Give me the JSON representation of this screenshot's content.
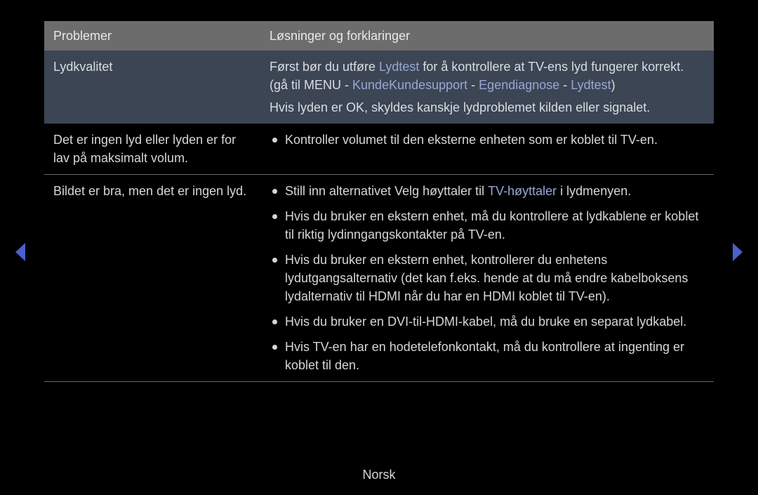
{
  "headers": {
    "problem": "Problemer",
    "solution": "Løsninger og forklaringer"
  },
  "row1": {
    "problem": "Lydkvalitet",
    "line1_pre": "Først bør du utføre ",
    "line1_hl": "Lydtest",
    "line1_post": " for å kontrollere at TV-ens lyd fungerer korrekt.",
    "line2_pre": "(gå til ",
    "line2_bold": "MENU",
    "line2_sep": " - ",
    "line2_hl1": "KundeKundesupport",
    "line2_hl2": "Egendiagnose",
    "line2_hl3": "Lydtest",
    "line2_close": ")",
    "line3_pre": "Hvis lyden er ",
    "line3_bold": "OK",
    "line3_post": ", skyldes kanskje lydproblemet kilden eller signalet."
  },
  "row2": {
    "problem": "Det er ingen lyd eller lyden er for lav på maksimalt volum.",
    "b1": "Kontroller volumet til den eksterne enheten som er koblet til TV-en."
  },
  "row3": {
    "problem": "Bildet er bra, men det er ingen lyd.",
    "b1_pre": "Still inn alternativet Velg høyttaler til ",
    "b1_hl": "TV-høyttaler",
    "b1_post": " i lydmenyen.",
    "b2": "Hvis du bruker en ekstern enhet, må du kontrollere at lydkablene er koblet til riktig lydinngangskontakter på TV-en.",
    "b3": "Hvis du bruker en ekstern enhet, kontrollerer du enhetens lydutgangsalternativ (det kan f.eks. hende at du må endre kabelboksens lydalternativ til HDMI når du har en HDMI koblet til TV-en).",
    "b4": "Hvis du bruker en DVI-til-HDMI-kabel, må du bruke en separat lydkabel.",
    "b5": "Hvis TV-en har en hodetelefonkontakt, må du kontrollere at ingenting er koblet til den."
  },
  "footer": "Norsk"
}
